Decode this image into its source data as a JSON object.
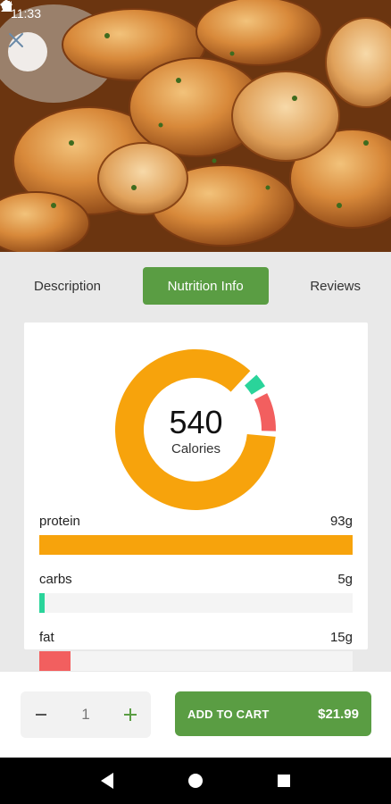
{
  "status_bar": {
    "time": "11:33"
  },
  "hero": {
    "image": "garlic-butter-shrimp-photo"
  },
  "tabs": [
    {
      "label": "Description",
      "active": false
    },
    {
      "label": "Nutrition Info",
      "active": true
    },
    {
      "label": "Reviews",
      "active": false
    }
  ],
  "nutrition": {
    "calories": "540",
    "calories_label": "Calories",
    "items": [
      {
        "name": "protein",
        "amount": "93g",
        "fraction": 1.0,
        "color": "#f7a30c"
      },
      {
        "name": "carbs",
        "amount": "5g",
        "fraction": 0.017,
        "color": "#2ad49a"
      },
      {
        "name": "fat",
        "amount": "15g",
        "fraction": 0.1,
        "color": "#f25f5f"
      }
    ],
    "donut_colors": {
      "protein": "#f7a30c",
      "carbs": "#2ad49a",
      "fat": "#f25f5f"
    }
  },
  "cart": {
    "quantity": "1",
    "decrement_icon": "minus-icon",
    "increment_icon": "plus-icon",
    "add_label": "ADD TO CART",
    "price": "$21.99"
  },
  "colors": {
    "accent": "#5a9d43"
  }
}
